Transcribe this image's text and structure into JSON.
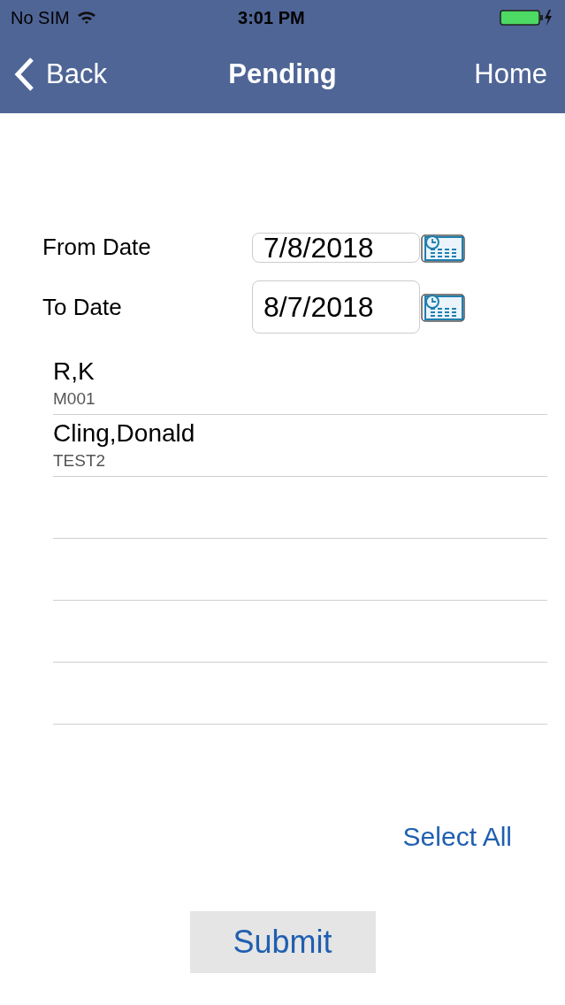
{
  "status_bar": {
    "carrier": "No SIM",
    "time": "3:01 PM"
  },
  "nav_bar": {
    "back": "Back",
    "title": "Pending",
    "home": "Home"
  },
  "form": {
    "fields": [
      {
        "label": "From Date",
        "value": "7/8/2018"
      },
      {
        "label": "To Date",
        "value": "8/7/2018"
      }
    ]
  },
  "list": {
    "items": [
      {
        "name": "R,K",
        "code": "M001"
      },
      {
        "name": "Cling,Donald",
        "code": "TEST2"
      }
    ]
  },
  "select_all": "Select All",
  "submit": "Submit"
}
